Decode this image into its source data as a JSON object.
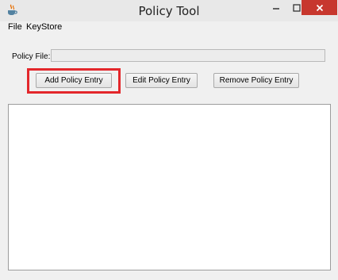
{
  "window": {
    "title": "Policy Tool",
    "icon": "java-cup-icon",
    "controls": [
      "minimize-icon",
      "maximize-icon",
      "close-icon"
    ],
    "close_color": "#c7372e"
  },
  "menu": {
    "items": [
      "File",
      "KeyStore"
    ]
  },
  "policy_file": {
    "label": "Policy File:",
    "value": ""
  },
  "buttons": {
    "add": "Add Policy Entry",
    "edit": "Edit Policy Entry",
    "remove": "Remove Policy Entry"
  },
  "entries": [],
  "highlight_color": "#e3272b"
}
